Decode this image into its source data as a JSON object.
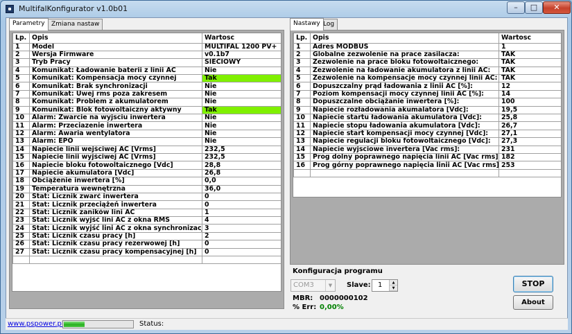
{
  "window": {
    "title": "MultifalKonfigurator v1.0b01",
    "min_label": "–",
    "max_label": "□",
    "close_label": "✕"
  },
  "left_panel": {
    "tabs": [
      "Parametry",
      "Zmiana nastaw"
    ],
    "active_tab": 0,
    "columns": [
      "Lp.",
      "Opis",
      "Wartosc"
    ],
    "rows": [
      [
        "1",
        "Model",
        "MULTIFAL 1200 PV+"
      ],
      [
        "2",
        "Wersja Firmware",
        "v0.1b7"
      ],
      [
        "3",
        "Tryb Pracy",
        "SIECIOWY"
      ],
      [
        "4",
        "Komunikat: Ładowanie baterii z linii AC",
        "Nie"
      ],
      [
        "5",
        "Komunikat: Kompensacja mocy czynnej",
        "Tak"
      ],
      [
        "6",
        "Komunikat: Brak synchronizacji",
        "Nie"
      ],
      [
        "7",
        "Komunikat: Uwej rms poza zakresem",
        "Nie"
      ],
      [
        "8",
        "Komunikat: Problem z akumulatorem",
        "Nie"
      ],
      [
        "9",
        "Komunikat: Blok fotowoltaiczny aktywny",
        "Tak"
      ],
      [
        "10",
        "Alarm: Zwarcie na wyjsciu inwertera",
        "Nie"
      ],
      [
        "11",
        "Alarm: Przeciazenie inwertera",
        "Nie"
      ],
      [
        "12",
        "Alarm: Awaria wentylatora",
        "Nie"
      ],
      [
        "13",
        "Alarm: EPO",
        "Nie"
      ],
      [
        "14",
        "Napiecie linii wejściwej AC [Vrms]",
        "232,5"
      ],
      [
        "15",
        "Napiecie linii wyjściwej AC [Vrms]",
        "232,5"
      ],
      [
        "16",
        "Napiecie bloku fotowoltaicznego [Vdc]",
        "28,8"
      ],
      [
        "17",
        "Napiecie akumulatora [Vdc]",
        "26,8"
      ],
      [
        "18",
        "Obciążenie inwertera [%]",
        "0,0"
      ],
      [
        "19",
        "Temperatura wewnętrzna",
        "36,0"
      ],
      [
        "20",
        "Stat: Licznik zwarć inwertera",
        "0"
      ],
      [
        "21",
        "Stat: Licznik przeciążeń inwertera",
        "0"
      ],
      [
        "22",
        "Stat: Licznik zaników lini AC",
        "1"
      ],
      [
        "23",
        "Stat: Licznik wyjść lini AC z okna RMS",
        "4"
      ],
      [
        "24",
        "Stat: Licznik wyjść lini AC z okna synchronizacji",
        "3"
      ],
      [
        "25",
        "Stat: Licznik czasu pracy [h]",
        "2"
      ],
      [
        "26",
        "Stat: Licznik czasu pracy rezerwowej [h]",
        "0"
      ],
      [
        "27",
        "Stat: Licznik czasu pracy kompensacyjnej [h]",
        "0"
      ]
    ],
    "highlight_rows": [
      4,
      8
    ],
    "highlight_color": "#80f000"
  },
  "right_panel": {
    "tabs": [
      "Nastawy",
      "Log"
    ],
    "active_tab": 0,
    "columns": [
      "Lp.",
      "Opis",
      "Wartosc"
    ],
    "rows": [
      [
        "1",
        "Adres MODBUS",
        "1"
      ],
      [
        "2",
        "Globalne zezwolenie na prace zasilacza:",
        "TAK"
      ],
      [
        "3",
        "Zezwolenie na prace bloku fotowoltaicznego:",
        "TAK"
      ],
      [
        "4",
        "Zezwolenie na ładowanie akumulatora z linii AC:",
        "TAK"
      ],
      [
        "5",
        "Zezwolenie na kompensacje mocy czynnej linii AC:",
        "TAK"
      ],
      [
        "6",
        "Dopuszczalny prąd ładowania z linii AC [%]:",
        "12"
      ],
      [
        "7",
        "Poziom kompensacji mocy czynnej linii AC [%]:",
        "14"
      ],
      [
        "8",
        "Dopuszczalne obciążanie inwertera [%]:",
        "100"
      ],
      [
        "9",
        "Napiecie rozładowania akumalatora [Vdc]:",
        "19,5"
      ],
      [
        "10",
        "Napiecie startu ładowania akumulatora [Vdc]:",
        "25,8"
      ],
      [
        "11",
        "Napiecie stopu ładowania akumulatora [Vdc]:",
        "26,7"
      ],
      [
        "12",
        "Napiecie start kompensacji mocy czynnej [Vdc]:",
        "27,1"
      ],
      [
        "13",
        "Napiecie regulacji bloku fotowoltaicznego [Vdc]:",
        "27,3"
      ],
      [
        "14",
        "Napiecie wyjsciowe invertera [Vac rms]:",
        "231"
      ],
      [
        "15",
        "Prog dolny poprawnego napięcia linii AC [Vac rms]:",
        "182"
      ],
      [
        "16",
        "Prog górny poprawnego napięcia linii AC [Vac rms]:",
        "253"
      ]
    ]
  },
  "config": {
    "title": "Konfiguracja programu",
    "port_value": "COM3",
    "slave_label": "Slave:",
    "slave_value": "1",
    "mbr_label": "MBR:",
    "mbr_value": "0000000102",
    "err_label": "% Err:",
    "err_value": "0,00%",
    "err_color": "#008000",
    "stop_label": "STOP",
    "about_label": "About"
  },
  "statusbar": {
    "link": "www.pspower.pl",
    "progress_fraction": 0.3,
    "status_label": "Status:"
  }
}
